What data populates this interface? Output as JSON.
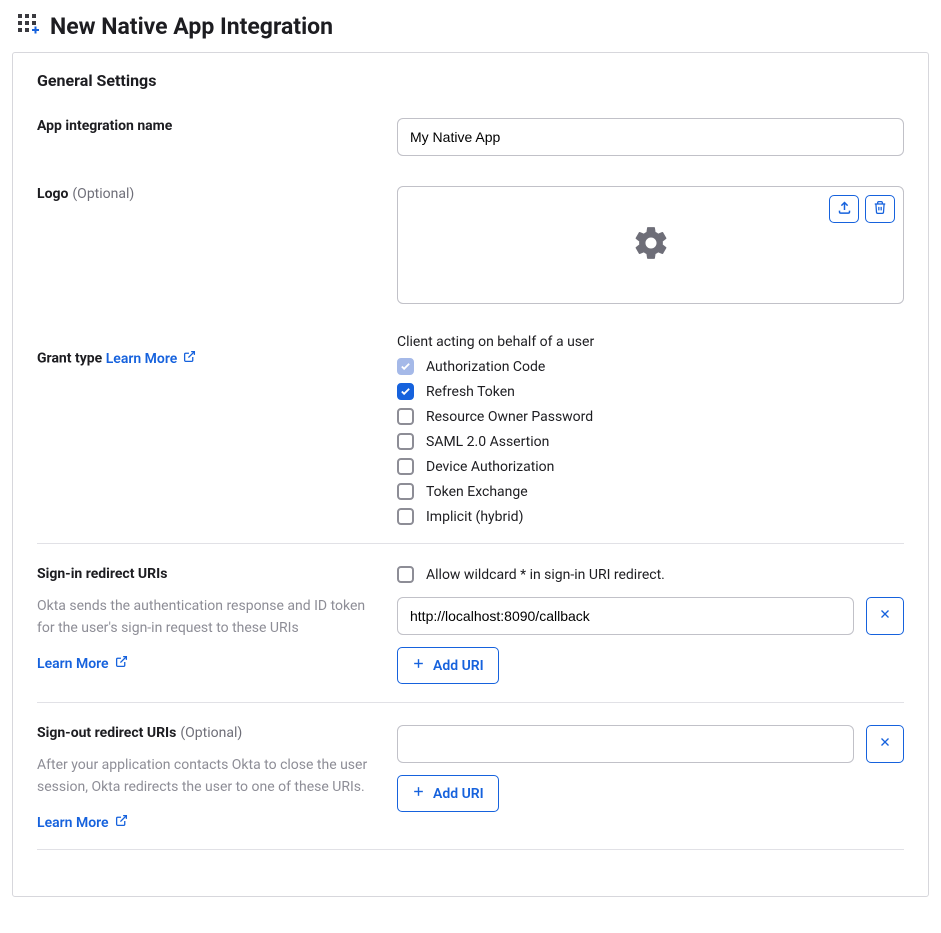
{
  "header": {
    "title": "New Native App Integration"
  },
  "section": {
    "heading": "General Settings"
  },
  "appName": {
    "label": "App integration name",
    "value": "My Native App"
  },
  "logo": {
    "label": "Logo",
    "optional": "(Optional)"
  },
  "grant": {
    "label": "Grant type",
    "learnMore": "Learn More",
    "sub": "Client acting on behalf of a user",
    "options": [
      {
        "label": "Authorization Code",
        "state": "checked-disabled"
      },
      {
        "label": "Refresh Token",
        "state": "checked"
      },
      {
        "label": "Resource Owner Password",
        "state": "unchecked"
      },
      {
        "label": "SAML 2.0 Assertion",
        "state": "unchecked"
      },
      {
        "label": "Device Authorization",
        "state": "unchecked"
      },
      {
        "label": "Token Exchange",
        "state": "unchecked"
      },
      {
        "label": "Implicit (hybrid)",
        "state": "unchecked"
      }
    ]
  },
  "signIn": {
    "label": "Sign-in redirect URIs",
    "help": "Okta sends the authentication response and ID token for the user's sign-in request to these URIs",
    "learnMore": "Learn More",
    "allowWildcard": "Allow wildcard * in sign-in URI redirect.",
    "uri": "http://localhost:8090/callback",
    "addUri": "Add URI"
  },
  "signOut": {
    "label": "Sign-out redirect URIs",
    "optional": "(Optional)",
    "help": "After your application contacts Okta to close the user session, Okta redirects the user to one of these URIs.",
    "learnMore": "Learn More",
    "uri": "",
    "addUri": "Add URI"
  }
}
